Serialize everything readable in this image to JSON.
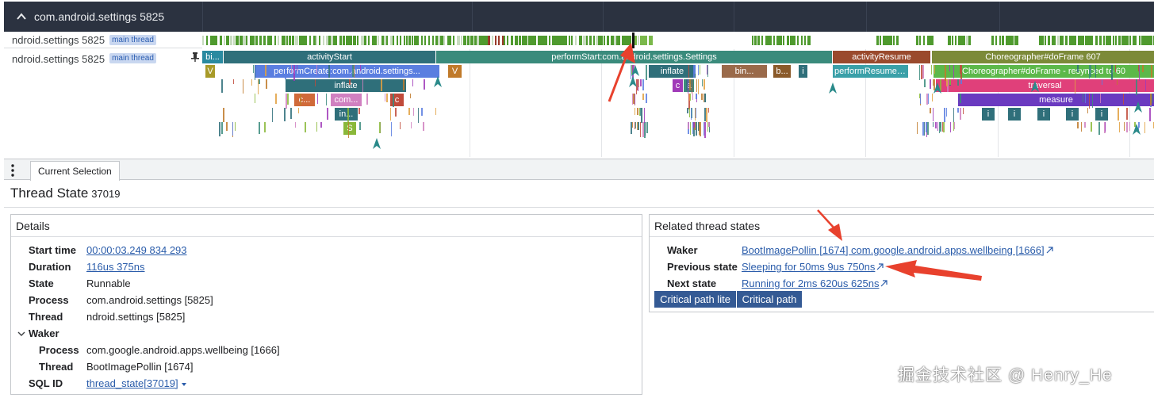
{
  "process_header": {
    "title": "com.android.settings 5825"
  },
  "tracks": [
    {
      "name": "ndroid.settings 5825",
      "tag": "main thread"
    },
    {
      "name": "ndroid.settings 5825",
      "tag": "main thread"
    }
  ],
  "slices": [
    {
      "label": "bi...",
      "color": "#2a8aa0",
      "level": 0
    },
    {
      "label": "activityStart",
      "color": "#2f6f7a",
      "level": 0
    },
    {
      "label": "performStart:com.android.settings.Settings",
      "color": "#3a8b7c",
      "level": 0
    },
    {
      "label": "activityResume",
      "color": "#9a4a2d",
      "level": 0
    },
    {
      "label": "Choreographer#doFrame 607",
      "color": "#7c8a38",
      "level": 0
    },
    {
      "label": "V",
      "color": "#a89a28",
      "level": 1
    },
    {
      "label": "performCreate:com.android.settings...",
      "color": "#5a7ee0",
      "level": 1
    },
    {
      "label": "V",
      "color": "#c07a2a",
      "level": 1
    },
    {
      "label": "inflate",
      "color": "#2f6f7a",
      "level": 1
    },
    {
      "label": "bin...",
      "color": "#9a6a4a",
      "level": 1
    },
    {
      "label": "b...",
      "color": "#8a5a2a",
      "level": 1
    },
    {
      "label": "i",
      "color": "#2f6f7a",
      "level": 1
    },
    {
      "label": "performResume:...",
      "color": "#3aa0a8",
      "level": 1
    },
    {
      "label": "Choreographer#doFrame - resynced to 60",
      "color": "#5cb84a",
      "level": 1
    },
    {
      "label": "inflate",
      "color": "#2f6f7a",
      "level": 2
    },
    {
      "label": "c",
      "color": "#a03ab8",
      "level": 2
    },
    {
      "label": "a",
      "color": "#3a8b7c",
      "level": 2
    },
    {
      "label": "traversal",
      "color": "#e0407a",
      "level": 2
    },
    {
      "label": "c...",
      "color": "#d06a3a",
      "level": 3
    },
    {
      "label": "com...",
      "color": "#d080c0",
      "level": 3
    },
    {
      "label": "c",
      "color": "#c04a3a",
      "level": 3
    },
    {
      "label": "measure",
      "color": "#6a3ac0",
      "level": 3
    },
    {
      "label": "in...",
      "color": "#2f6f7a",
      "level": 4
    },
    {
      "label": "i",
      "color": "#2f6f7a",
      "level": 4
    },
    {
      "label": "i",
      "color": "#2f6f7a",
      "level": 4
    },
    {
      "label": "i",
      "color": "#2f6f7a",
      "level": 4
    },
    {
      "label": "i",
      "color": "#2f6f7a",
      "level": 4
    },
    {
      "label": "i",
      "color": "#2f6f7a",
      "level": 4
    },
    {
      "label": "S",
      "color": "#8ab83a",
      "level": 5
    }
  ],
  "tabs": {
    "current": "Current Selection"
  },
  "selection": {
    "title": "Thread State",
    "id": "37019"
  },
  "details": {
    "heading": "Details",
    "start_time_label": "Start time",
    "start_time": "00:00:03.249 834 293",
    "duration_label": "Duration",
    "duration": "116us 375ns",
    "state_label": "State",
    "state": "Runnable",
    "process_label": "Process",
    "process": "com.android.settings [5825]",
    "thread_label": "Thread",
    "thread": "ndroid.settings [5825]",
    "waker_label": "Waker",
    "waker_process_label": "Process",
    "waker_process": "com.google.android.apps.wellbeing [1666]",
    "waker_thread_label": "Thread",
    "waker_thread": "BootImagePollin [1674]",
    "sql_id_label": "SQL ID",
    "sql_id": "thread_state[37019]"
  },
  "related": {
    "heading": "Related thread states",
    "waker_label": "Waker",
    "waker": "BootImagePollin [1674] com.google.android.apps.wellbeing [1666]",
    "previous_label": "Previous state",
    "previous": "Sleeping for 50ms 9us 750ns",
    "next_label": "Next state",
    "next": "Running for 2ms 620us 625ns",
    "btn_critical_lite": "Critical path lite",
    "btn_critical": "Critical path"
  },
  "watermark": "掘金技术社区 @ Henry_He",
  "colors": {
    "annotation_arrow": "#e8412d",
    "link": "#2a5caa",
    "button": "#345a94",
    "header_bg": "#2b3240"
  }
}
